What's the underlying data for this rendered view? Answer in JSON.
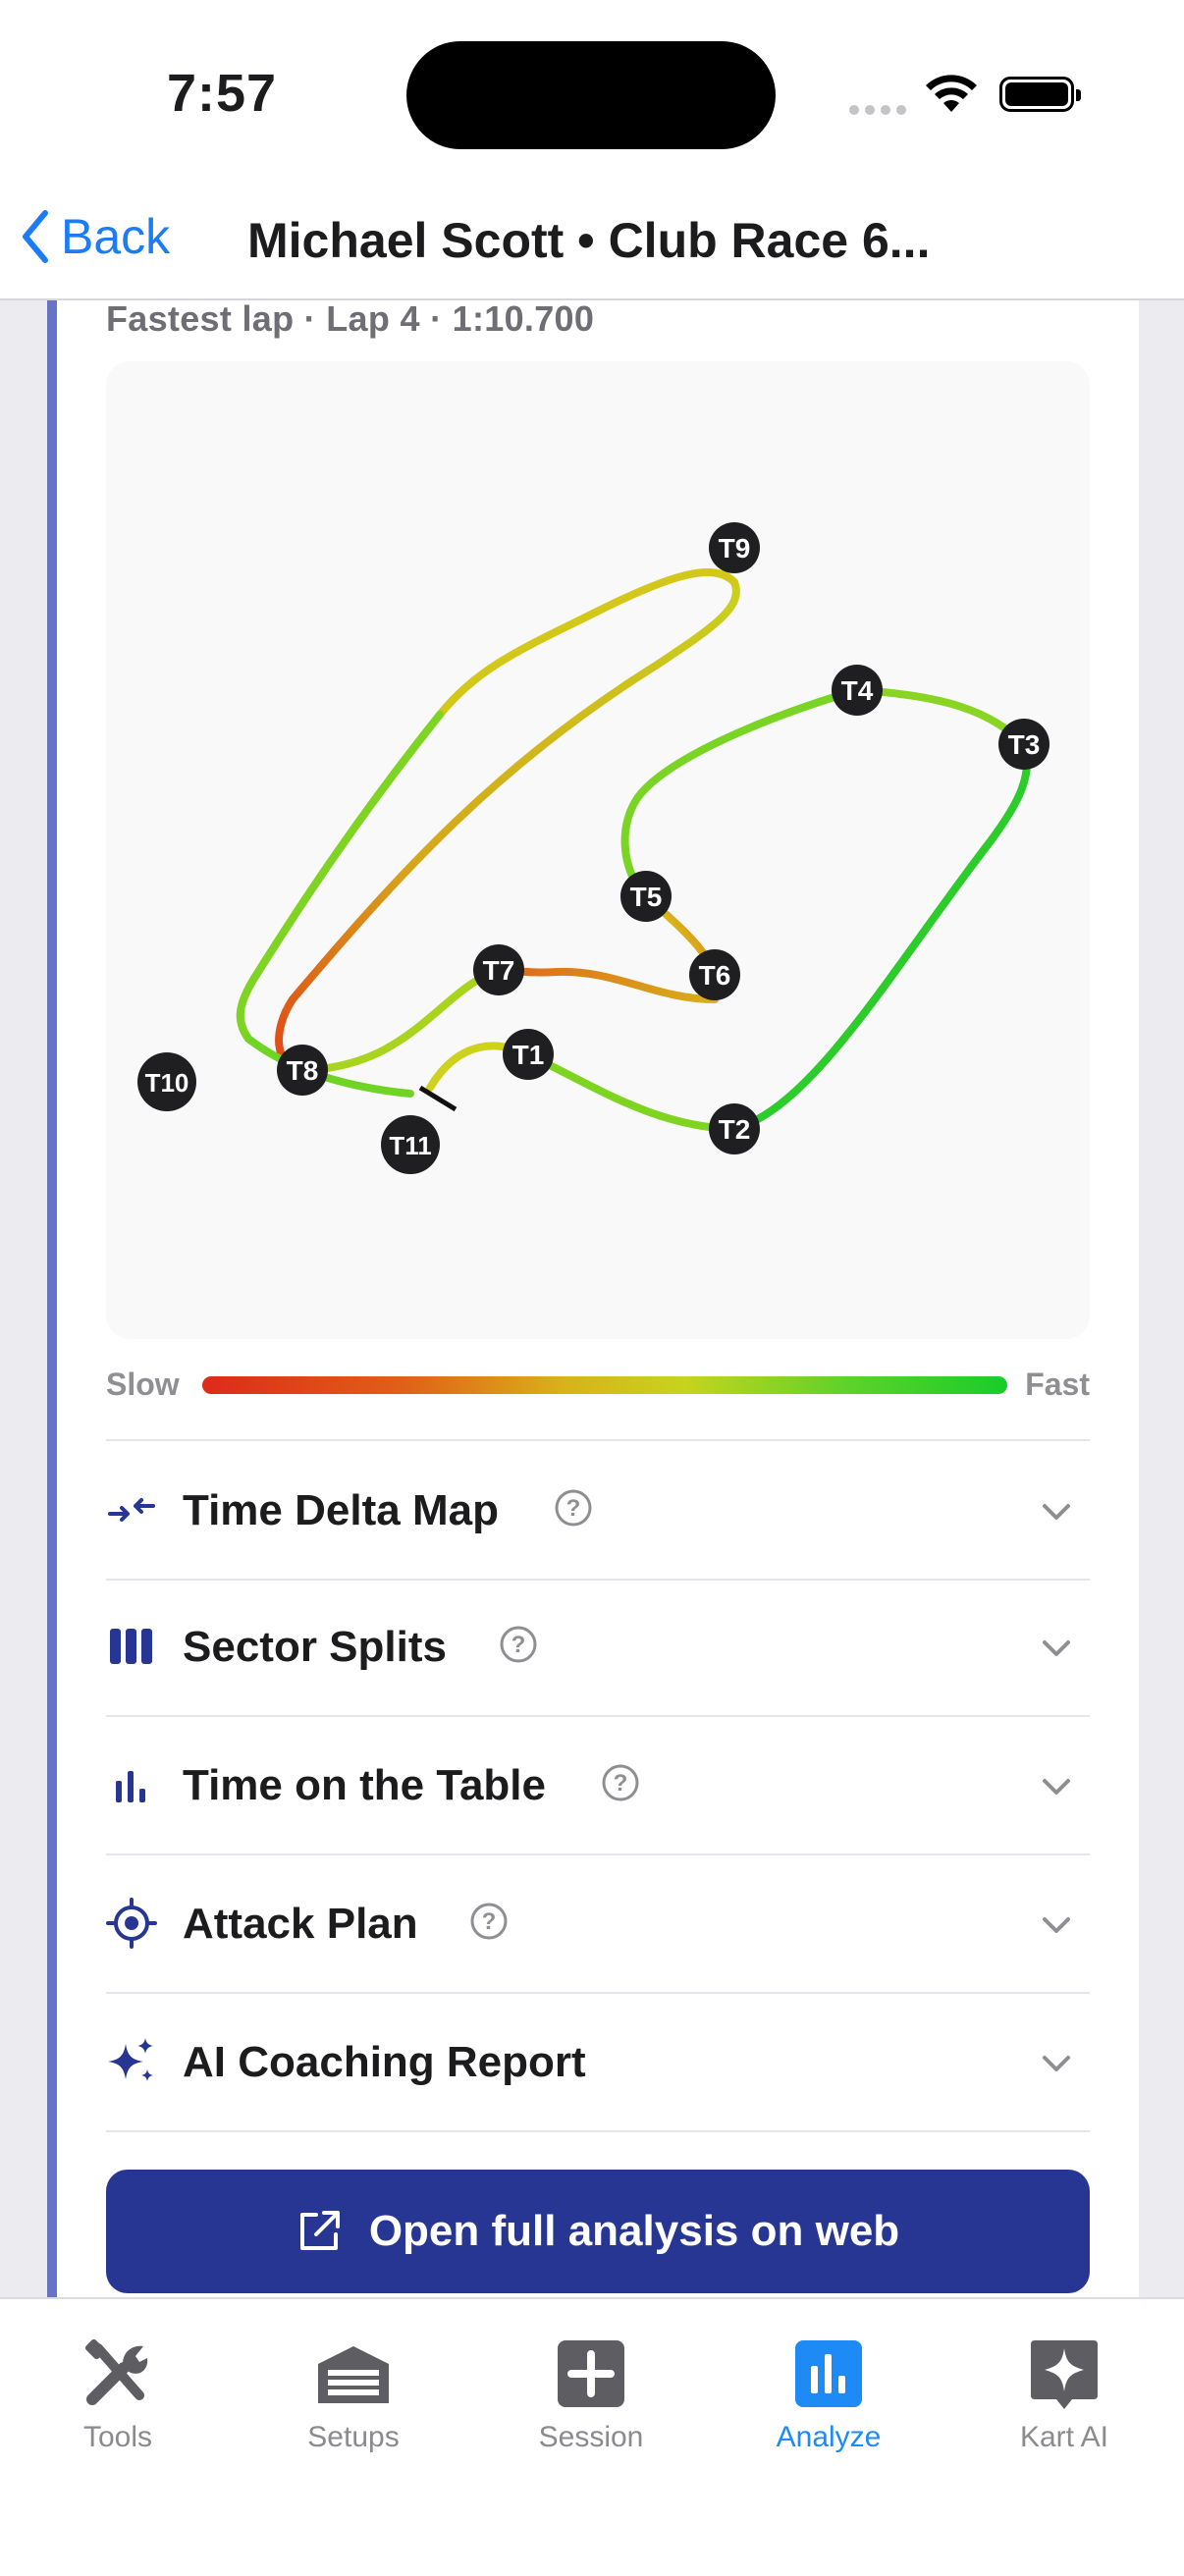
{
  "status_bar": {
    "time": "7:57"
  },
  "nav": {
    "back_label": "Back",
    "title": "Michael Scott • Club Race 6..."
  },
  "lap_info": "Fastest lap · Lap 4 · 1:10.700",
  "track_map": {
    "turns": [
      "T1",
      "T2",
      "T3",
      "T4",
      "T5",
      "T6",
      "T7",
      "T8",
      "T9",
      "T10",
      "T11"
    ]
  },
  "legend": {
    "slow": "Slow",
    "fast": "Fast",
    "slow_color": "#de2a1a",
    "fast_color": "#19cc29"
  },
  "sections": [
    {
      "label": "Time Delta Map",
      "icon": "arrows-converge-icon",
      "has_help": true
    },
    {
      "label": "Sector Splits",
      "icon": "columns-icon",
      "has_help": true
    },
    {
      "label": "Time on the Table",
      "icon": "bar-chart-icon",
      "has_help": true
    },
    {
      "label": "Attack Plan",
      "icon": "target-icon",
      "has_help": true
    },
    {
      "label": "AI Coaching Report",
      "icon": "sparkles-icon",
      "has_help": false
    }
  ],
  "web_button": {
    "label": "Open full analysis on web",
    "color": "#273693"
  },
  "tabs": [
    {
      "label": "Tools",
      "icon": "tools-icon",
      "active": false
    },
    {
      "label": "Setups",
      "icon": "garage-icon",
      "active": false
    },
    {
      "label": "Session",
      "icon": "plus-square-icon",
      "active": false
    },
    {
      "label": "Analyze",
      "icon": "analyze-chart-icon",
      "active": true
    },
    {
      "label": "Kart AI",
      "icon": "sparkle-square-icon",
      "active": false
    }
  ],
  "colors": {
    "accent": "#1e8af5",
    "card_stripe": "#6873c6",
    "section_icon": "#273693"
  }
}
